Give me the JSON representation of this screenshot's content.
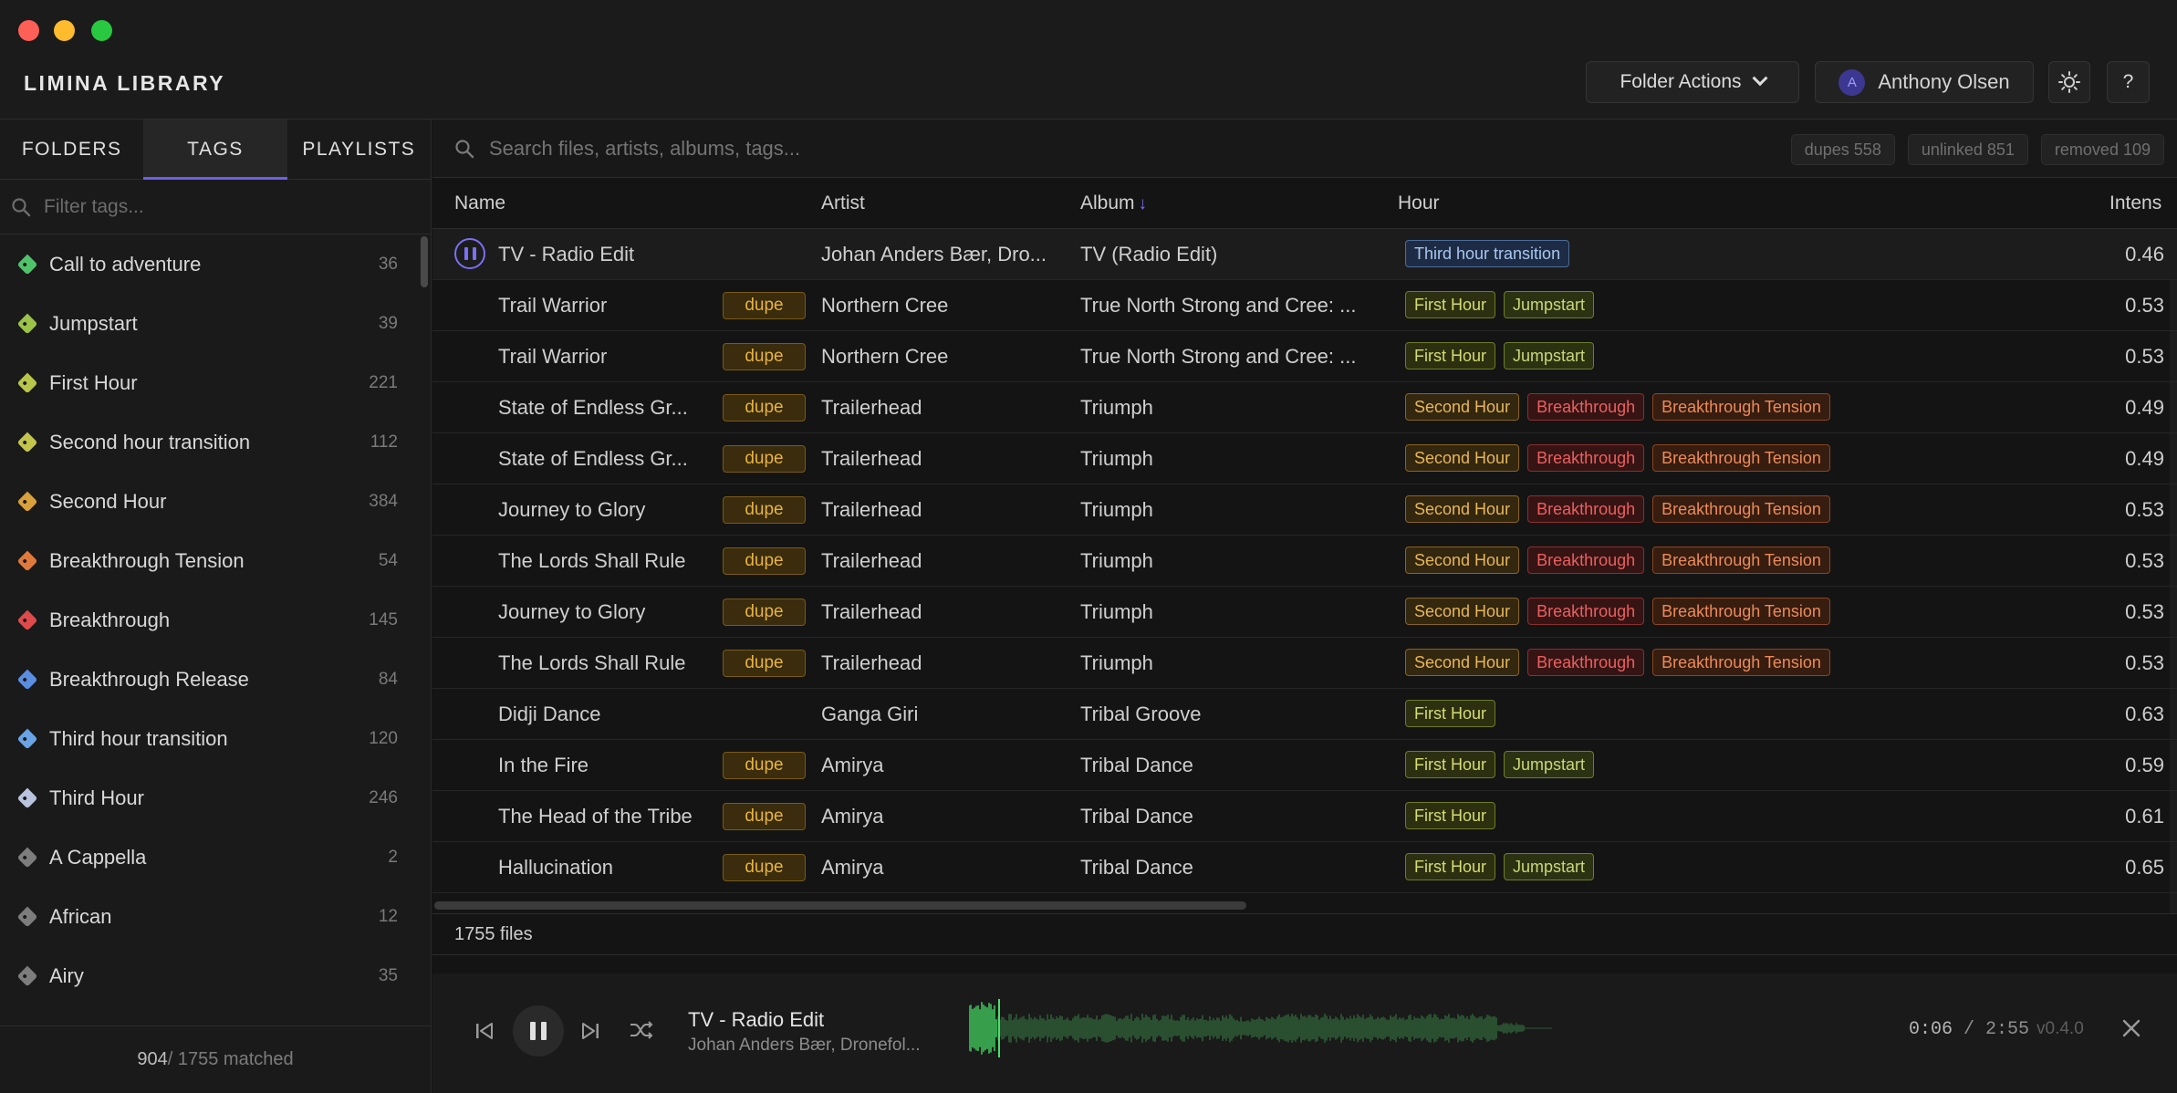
{
  "app": {
    "title": "LIMINA LIBRARY"
  },
  "header": {
    "folder_actions": "Folder Actions",
    "user_initial": "A",
    "user_name": "Anthony Olsen",
    "help": "?"
  },
  "sidebar": {
    "tabs": [
      "FOLDERS",
      "TAGS",
      "PLAYLISTS"
    ],
    "active_tab": "TAGS",
    "filter_placeholder": "Filter tags...",
    "tags": [
      {
        "label": "Call to adventure",
        "count": "36",
        "color": "#4fc36a"
      },
      {
        "label": "Jumpstart",
        "count": "39",
        "color": "#9cc24a"
      },
      {
        "label": "First Hour",
        "count": "221",
        "color": "#b8c64a"
      },
      {
        "label": "Second hour transition",
        "count": "112",
        "color": "#c3c44a"
      },
      {
        "label": "Second Hour",
        "count": "384",
        "color": "#d9a03b"
      },
      {
        "label": "Breakthrough Tension",
        "count": "54",
        "color": "#e07a3c"
      },
      {
        "label": "Breakthrough",
        "count": "145",
        "color": "#e04a4a"
      },
      {
        "label": "Breakthrough Release",
        "count": "84",
        "color": "#5b8de0"
      },
      {
        "label": "Third hour transition",
        "count": "120",
        "color": "#6aa4e6"
      },
      {
        "label": "Third Hour",
        "count": "246",
        "color": "#b9c3dd"
      },
      {
        "label": "A Cappella",
        "count": "2",
        "color": "#7d7d7d"
      },
      {
        "label": "African",
        "count": "12",
        "color": "#7d7d7d"
      },
      {
        "label": "Airy",
        "count": "35",
        "color": "#7d7d7d"
      }
    ],
    "footer": {
      "matched": "904",
      "total": " / 1755 matched"
    }
  },
  "search": {
    "placeholder": "Search files, artists, albums, tags...",
    "badges": [
      "dupes 558",
      "unlinked 851",
      "removed 109"
    ]
  },
  "table": {
    "columns": {
      "name": "Name",
      "artist": "Artist",
      "album": "Album",
      "album_sort": "↓",
      "hour": "Hour",
      "intensity": "Intens"
    },
    "dupe_label": "dupe",
    "rows": [
      {
        "name": "TV - Radio Edit",
        "dupe": false,
        "playing": true,
        "artist": "Johan Anders Bær, Dro...",
        "album": "TV (Radio Edit)",
        "tags": [
          "Third hour transition"
        ],
        "intensity": "0.46"
      },
      {
        "name": "Trail Warrior",
        "dupe": true,
        "artist": "Northern Cree",
        "album": "True North Strong and Cree: ...",
        "tags": [
          "First Hour",
          "Jumpstart"
        ],
        "intensity": "0.53"
      },
      {
        "name": "Trail Warrior",
        "dupe": true,
        "artist": "Northern Cree",
        "album": "True North Strong and Cree: ...",
        "tags": [
          "First Hour",
          "Jumpstart"
        ],
        "intensity": "0.53"
      },
      {
        "name": "State of Endless Gr...",
        "dupe": true,
        "artist": "Trailerhead",
        "album": "Triumph",
        "tags": [
          "Second Hour",
          "Breakthrough",
          "Breakthrough Tension"
        ],
        "intensity": "0.49"
      },
      {
        "name": "State of Endless Gr...",
        "dupe": true,
        "artist": "Trailerhead",
        "album": "Triumph",
        "tags": [
          "Second Hour",
          "Breakthrough",
          "Breakthrough Tension"
        ],
        "intensity": "0.49"
      },
      {
        "name": "Journey to Glory",
        "dupe": true,
        "artist": "Trailerhead",
        "album": "Triumph",
        "tags": [
          "Second Hour",
          "Breakthrough",
          "Breakthrough Tension"
        ],
        "intensity": "0.53"
      },
      {
        "name": "The Lords Shall Rule",
        "dupe": true,
        "artist": "Trailerhead",
        "album": "Triumph",
        "tags": [
          "Second Hour",
          "Breakthrough",
          "Breakthrough Tension"
        ],
        "intensity": "0.53"
      },
      {
        "name": "Journey to Glory",
        "dupe": true,
        "artist": "Trailerhead",
        "album": "Triumph",
        "tags": [
          "Second Hour",
          "Breakthrough",
          "Breakthrough Tension"
        ],
        "intensity": "0.53"
      },
      {
        "name": "The Lords Shall Rule",
        "dupe": true,
        "artist": "Trailerhead",
        "album": "Triumph",
        "tags": [
          "Second Hour",
          "Breakthrough",
          "Breakthrough Tension"
        ],
        "intensity": "0.53"
      },
      {
        "name": "Didji Dance",
        "dupe": false,
        "artist": "Ganga Giri",
        "album": "Tribal Groove",
        "tags": [
          "First Hour"
        ],
        "intensity": "0.63"
      },
      {
        "name": "In the Fire",
        "dupe": true,
        "artist": "Amirya",
        "album": "Tribal Dance",
        "tags": [
          "First Hour",
          "Jumpstart"
        ],
        "intensity": "0.59"
      },
      {
        "name": "The Head of the Tribe",
        "dupe": true,
        "artist": "Amirya",
        "album": "Tribal Dance",
        "tags": [
          "First Hour"
        ],
        "intensity": "0.61"
      },
      {
        "name": "Hallucination",
        "dupe": true,
        "artist": "Amirya",
        "album": "Tribal Dance",
        "tags": [
          "First Hour",
          "Jumpstart"
        ],
        "intensity": "0.65"
      }
    ],
    "tag_styles": {
      "Third hour transition": {
        "bg": "#1d2c44",
        "border": "#4d6d9c",
        "color": "#a9c6f0"
      },
      "First Hour": {
        "bg": "#2c3010",
        "border": "#6f7a26",
        "color": "#d4dc72"
      },
      "Jumpstart": {
        "bg": "#2b3212",
        "border": "#6c7f2b",
        "color": "#c9d67a"
      },
      "Second Hour": {
        "bg": "#34270f",
        "border": "#8a6321",
        "color": "#e6b65a"
      },
      "Breakthrough": {
        "bg": "#371414",
        "border": "#8a2e2e",
        "color": "#ec5f5f"
      },
      "Breakthrough Tension": {
        "bg": "#371d10",
        "border": "#8c4521",
        "color": "#ec8a5a"
      }
    },
    "files_count": "1755 files"
  },
  "player": {
    "title": "TV - Radio Edit",
    "artist": "Johan Anders Bær, Dronefol...",
    "time_current": "0:06",
    "time_total": " / 2:55",
    "version": "v0.4.0",
    "progress": 0.034
  }
}
